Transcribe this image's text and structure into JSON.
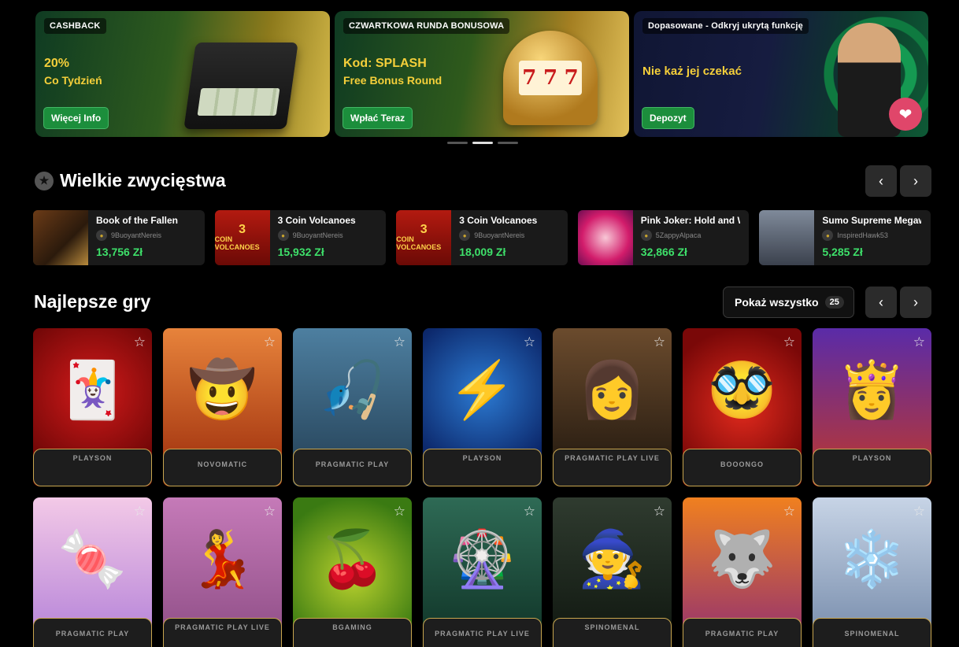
{
  "promos": [
    {
      "tag": "CASHBACK",
      "line1": "20%",
      "line2": "Co Tydzień",
      "cta": "Więcej Info"
    },
    {
      "tag": "CZWARTKOWA RUNDA BONUSOWA",
      "line1": "Kod: SPLASH",
      "line2": "Free Bonus Round",
      "cta": "Wpłać Teraz"
    },
    {
      "tag": "Dopasowane - Odkryj ukrytą funkcję",
      "line1": "Nie każ jej czekać",
      "cta": "Depozyt"
    }
  ],
  "big_wins": {
    "title": "Wielkie zwycięstwa",
    "prev": "‹",
    "next": "›",
    "items": [
      {
        "game": "Book of the Fallen",
        "user": "9BuoyantNereis",
        "amount": "13,756 Zł",
        "thumb_text": ""
      },
      {
        "game": "3 Coin Volcanoes",
        "user": "9BuoyantNereis",
        "amount": "15,932 Zł",
        "thumb_text": "3"
      },
      {
        "game": "3 Coin Volcanoes",
        "user": "9BuoyantNereis",
        "amount": "18,009 Zł",
        "thumb_text": "3"
      },
      {
        "game": "Pink Joker: Hold and Wi",
        "user": "5ZappyAlpaca",
        "amount": "32,866 Zł",
        "thumb_text": ""
      },
      {
        "game": "Sumo Supreme Megawa",
        "user": "InspiredHawk53",
        "amount": "5,285 Zł",
        "thumb_text": ""
      }
    ],
    "volcano_label": "COIN VOLCANOES"
  },
  "best_games": {
    "title": "Najlepsze gry",
    "show_all": "Pokaż wszystko",
    "count": "25",
    "prev": "‹",
    "next": "›",
    "providers": [
      "PLAYSON",
      "NOVOMATIC",
      "PRAGMATIC PLAY",
      "PLAYSON",
      "PRAGMATIC PLAY LIVE",
      "BOOONGO",
      "PLAYSON",
      "PRAGMATIC PLAY",
      "PRAGMATIC PLAY LIVE",
      "BGAMING",
      "PRAGMATIC PLAY LIVE",
      "SPINOMENAL",
      "PRAGMATIC PLAY",
      "SPINOMENAL"
    ],
    "icons": [
      "🃏",
      "🤠",
      "🎣",
      "⚡",
      "👩",
      "🥸",
      "👸",
      "🍬",
      "💃",
      "🍒",
      "🎡",
      "🧙",
      "🐺",
      "❄️"
    ]
  },
  "colors": {
    "accent_green": "#1c8e3c",
    "win_green": "#3ee06a",
    "gold_text": "#f5cf3a",
    "card_border": "#c9a64f"
  }
}
